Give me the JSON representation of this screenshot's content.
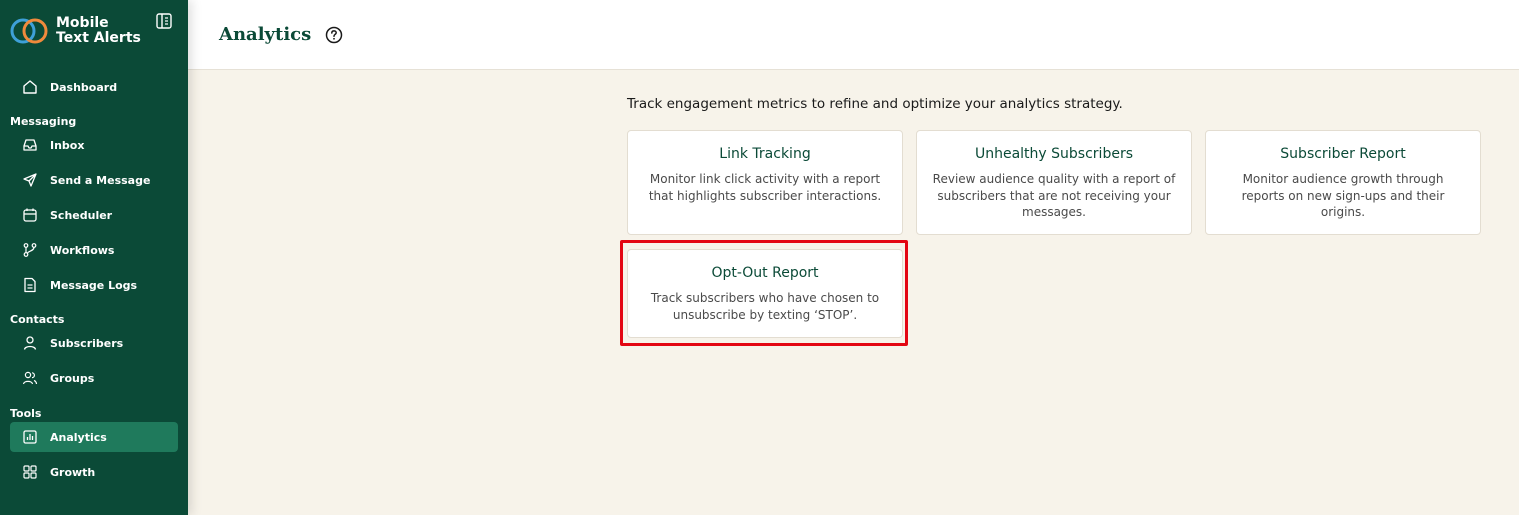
{
  "app": {
    "name_line1": "Mobile",
    "name_line2": "Text Alerts"
  },
  "header": {
    "title": "Analytics"
  },
  "sidebar": {
    "items": [
      {
        "label": "Dashboard",
        "icon": "home-icon"
      },
      {
        "label": "Inbox",
        "icon": "inbox-icon"
      },
      {
        "label": "Send a Message",
        "icon": "send-icon"
      },
      {
        "label": "Scheduler",
        "icon": "calendar-icon"
      },
      {
        "label": "Workflows",
        "icon": "workflow-icon"
      },
      {
        "label": "Message Logs",
        "icon": "document-icon"
      },
      {
        "label": "Subscribers",
        "icon": "user-icon"
      },
      {
        "label": "Groups",
        "icon": "users-icon"
      },
      {
        "label": "Analytics",
        "icon": "chart-icon",
        "active": true
      },
      {
        "label": "Growth",
        "icon": "grid-icon"
      }
    ],
    "sections": {
      "messaging": "Messaging",
      "contacts": "Contacts",
      "tools": "Tools"
    }
  },
  "main": {
    "intro": "Track engagement metrics to refine and optimize your analytics strategy.",
    "cards": [
      {
        "title": "Link Tracking",
        "desc_lines": [
          "Monitor link click activity with a report",
          "that highlights subscriber interactions."
        ]
      },
      {
        "title": "Unhealthy Subscribers",
        "desc_lines": [
          "Review audience quality with a report of",
          "subscribers that are not receiving your",
          "messages."
        ]
      },
      {
        "title": "Subscriber Report",
        "desc_lines": [
          "Monitor audience growth through",
          "reports on new sign-ups and their",
          "origins."
        ]
      },
      {
        "title": "Opt-Out Report",
        "desc_lines": [
          "Track subscribers who have chosen to",
          "unsubscribe by texting ‘STOP’."
        ]
      }
    ]
  },
  "colors": {
    "sidebar_bg": "#0b4a37",
    "active_bg": "#1f7a5c",
    "page_bg": "#f7f3ea",
    "highlight": "#e30613"
  }
}
